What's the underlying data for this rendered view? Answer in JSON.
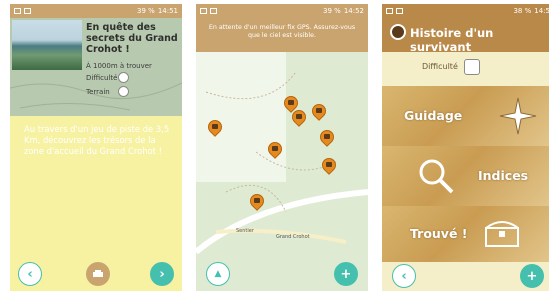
{
  "screen1": {
    "status_time": "14:51",
    "status_battery": "39 %",
    "title": "En quête des secrets du Grand Crohot !",
    "meta": {
      "distance": "À 1000m à trouver",
      "difficulty_label": "Difficulté",
      "terrain_label": "Terrain"
    },
    "description": "Au travers d'un jeu de piste de 3,5 Km, découvrez les trésors de la zone d'accueil du Grand Crohot !",
    "nav": {
      "prev": "‹",
      "next": "›"
    }
  },
  "screen2": {
    "status_time": "14:52",
    "status_battery": "39 %",
    "banner": "En attente d'un meilleur fix GPS. Assurez-vous que le ciel est visible.",
    "map_labels": {
      "road": "Grand Crohot",
      "path": "Sentier"
    },
    "fab_label": "+",
    "compass_label": "▲"
  },
  "screen3": {
    "status_time": "14:5",
    "status_battery": "38 %",
    "title": "Histoire d'un survivant",
    "difficulty_label": "Difficulté",
    "buttons": {
      "guidage": "Guidage",
      "indices": "Indices",
      "trouve": "Trouvé !"
    },
    "nav": {
      "prev": "‹",
      "fab": "+"
    }
  },
  "colors": {
    "yellow_bg": "#f7f1a2",
    "status_brown": "#c9a46e",
    "accent_teal": "#45bfae",
    "marker_orange": "#e58a1f"
  }
}
